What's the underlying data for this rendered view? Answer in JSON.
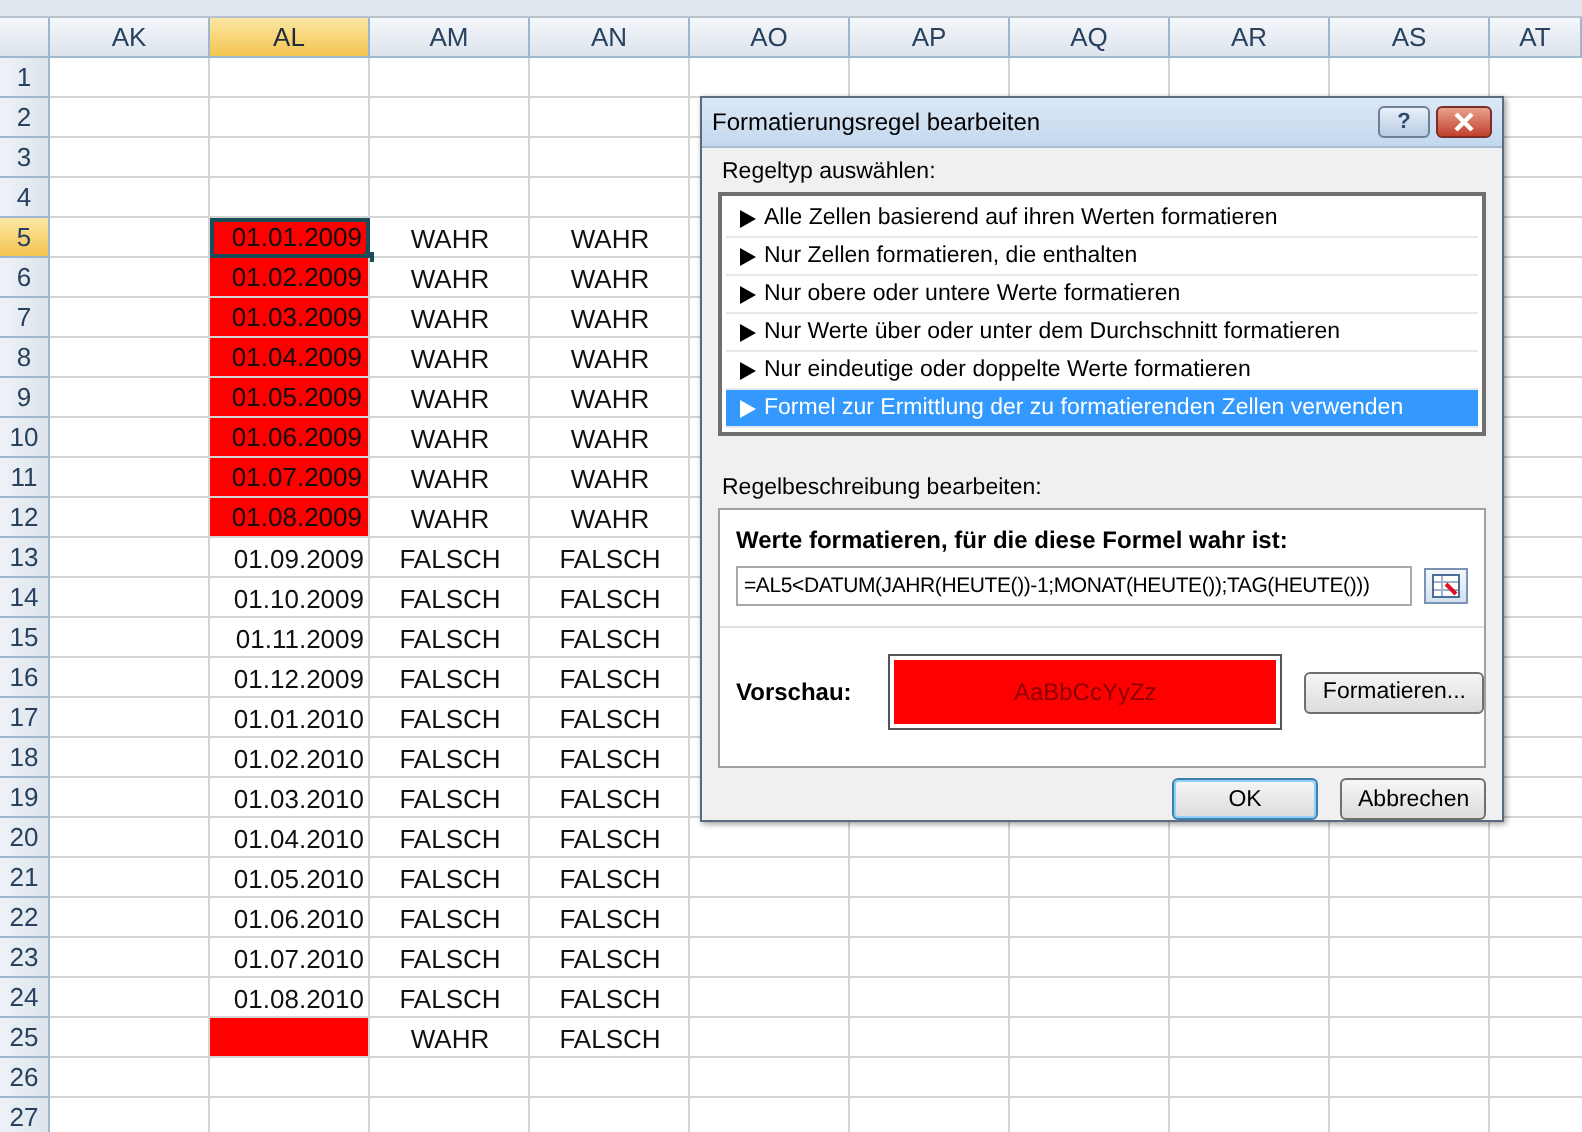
{
  "columns": [
    {
      "label": "AK",
      "selected": false
    },
    {
      "label": "AL",
      "selected": true
    },
    {
      "label": "AM",
      "selected": false
    },
    {
      "label": "AN",
      "selected": false
    },
    {
      "label": "AO",
      "selected": false
    },
    {
      "label": "AP",
      "selected": false
    },
    {
      "label": "AQ",
      "selected": false
    },
    {
      "label": "AR",
      "selected": false
    },
    {
      "label": "AS",
      "selected": false
    },
    {
      "label": "AT",
      "selected": false
    }
  ],
  "rows": [
    {
      "number": "1",
      "selected": false,
      "highlighted": false,
      "cells": []
    },
    {
      "number": "2",
      "selected": false,
      "highlighted": false,
      "cells": []
    },
    {
      "number": "3",
      "selected": false,
      "highlighted": false,
      "cells": []
    },
    {
      "number": "4",
      "selected": false,
      "highlighted": false,
      "cells": []
    },
    {
      "number": "5",
      "selected": true,
      "highlighted": true,
      "cells": [
        "01.01.2009",
        "WAHR",
        "WAHR"
      ]
    },
    {
      "number": "6",
      "selected": false,
      "highlighted": true,
      "cells": [
        "01.02.2009",
        "WAHR",
        "WAHR"
      ]
    },
    {
      "number": "7",
      "selected": false,
      "highlighted": true,
      "cells": [
        "01.03.2009",
        "WAHR",
        "WAHR"
      ]
    },
    {
      "number": "8",
      "selected": false,
      "highlighted": true,
      "cells": [
        "01.04.2009",
        "WAHR",
        "WAHR"
      ]
    },
    {
      "number": "9",
      "selected": false,
      "highlighted": true,
      "cells": [
        "01.05.2009",
        "WAHR",
        "WAHR"
      ]
    },
    {
      "number": "10",
      "selected": false,
      "highlighted": true,
      "cells": [
        "01.06.2009",
        "WAHR",
        "WAHR"
      ]
    },
    {
      "number": "11",
      "selected": false,
      "highlighted": true,
      "cells": [
        "01.07.2009",
        "WAHR",
        "WAHR"
      ]
    },
    {
      "number": "12",
      "selected": false,
      "highlighted": true,
      "cells": [
        "01.08.2009",
        "WAHR",
        "WAHR"
      ]
    },
    {
      "number": "13",
      "selected": false,
      "highlighted": false,
      "cells": [
        "01.09.2009",
        "FALSCH",
        "FALSCH"
      ]
    },
    {
      "number": "14",
      "selected": false,
      "highlighted": false,
      "cells": [
        "01.10.2009",
        "FALSCH",
        "FALSCH"
      ]
    },
    {
      "number": "15",
      "selected": false,
      "highlighted": false,
      "cells": [
        "01.11.2009",
        "FALSCH",
        "FALSCH"
      ]
    },
    {
      "number": "16",
      "selected": false,
      "highlighted": false,
      "cells": [
        "01.12.2009",
        "FALSCH",
        "FALSCH"
      ]
    },
    {
      "number": "17",
      "selected": false,
      "highlighted": false,
      "cells": [
        "01.01.2010",
        "FALSCH",
        "FALSCH"
      ]
    },
    {
      "number": "18",
      "selected": false,
      "highlighted": false,
      "cells": [
        "01.02.2010",
        "FALSCH",
        "FALSCH"
      ]
    },
    {
      "number": "19",
      "selected": false,
      "highlighted": false,
      "cells": [
        "01.03.2010",
        "FALSCH",
        "FALSCH"
      ]
    },
    {
      "number": "20",
      "selected": false,
      "highlighted": false,
      "cells": [
        "01.04.2010",
        "FALSCH",
        "FALSCH"
      ]
    },
    {
      "number": "21",
      "selected": false,
      "highlighted": false,
      "cells": [
        "01.05.2010",
        "FALSCH",
        "FALSCH"
      ]
    },
    {
      "number": "22",
      "selected": false,
      "highlighted": false,
      "cells": [
        "01.06.2010",
        "FALSCH",
        "FALSCH"
      ]
    },
    {
      "number": "23",
      "selected": false,
      "highlighted": false,
      "cells": [
        "01.07.2010",
        "FALSCH",
        "FALSCH"
      ]
    },
    {
      "number": "24",
      "selected": false,
      "highlighted": false,
      "cells": [
        "01.08.2010",
        "FALSCH",
        "FALSCH"
      ]
    },
    {
      "number": "25",
      "selected": false,
      "highlighted": true,
      "cells": [
        "",
        "WAHR",
        "FALSCH"
      ]
    },
    {
      "number": "26",
      "selected": false,
      "highlighted": false,
      "cells": []
    },
    {
      "number": "27",
      "selected": false,
      "highlighted": false,
      "cells": []
    }
  ],
  "dialog": {
    "title": "Formatierungsregel bearbeiten",
    "help_button": "?",
    "rule_type_label": "Regeltyp auswählen:",
    "rule_types": [
      {
        "label": "Alle Zellen basierend auf ihren Werten formatieren",
        "selected": false
      },
      {
        "label": "Nur Zellen formatieren, die enthalten",
        "selected": false
      },
      {
        "label": "Nur obere oder untere Werte formatieren",
        "selected": false
      },
      {
        "label": "Nur Werte über oder unter dem Durchschnitt formatieren",
        "selected": false
      },
      {
        "label": "Nur eindeutige oder doppelte Werte formatieren",
        "selected": false
      },
      {
        "label": "Formel zur Ermittlung der zu formatierenden Zellen verwenden",
        "selected": true
      }
    ],
    "description_label": "Regelbeschreibung bearbeiten:",
    "formula_heading": "Werte formatieren, für die diese Formel wahr ist:",
    "formula": "=AL5<DATUM(JAHR(HEUTE())-1;MONAT(HEUTE());TAG(HEUTE()))",
    "preview_label": "Vorschau:",
    "preview_text": "AaBbCcYyZz",
    "format_button": "Formatieren...",
    "buttons": [
      {
        "label": "OK",
        "kind": "default"
      },
      {
        "label": "Abbrechen",
        "kind": "normal"
      }
    ]
  }
}
